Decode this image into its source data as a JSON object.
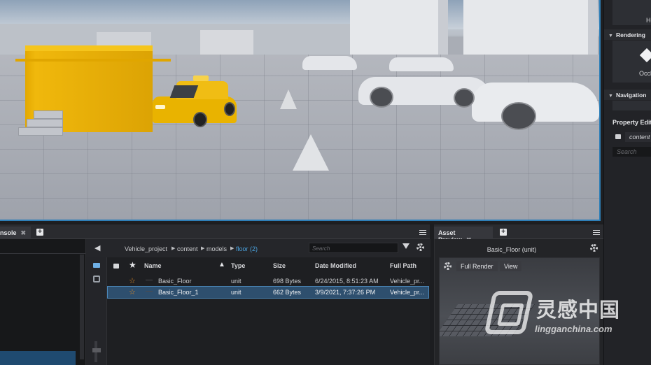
{
  "right_dock": {
    "top_label": "He",
    "section_rendering": "Rendering",
    "tile_label": "Occlud",
    "section_navigation": "Navigation",
    "property_editor_title": "Property Edito",
    "property_field_value": "content",
    "search_placeholder": "Search"
  },
  "console_panel": {
    "tab_label": "nsole"
  },
  "file_browser": {
    "breadcrumb": [
      "Vehicle_project",
      "content",
      "models"
    ],
    "current_folder": "floor (2)",
    "search_placeholder": "Search",
    "columns": [
      "Name",
      "Type",
      "Size",
      "Date Modified",
      "Full Path"
    ],
    "rows": [
      {
        "name": "Basic_Floor",
        "type": "unit",
        "size": "698 Bytes",
        "date": "6/24/2015, 8:51:23 AM",
        "path": "Vehicle_pr...",
        "selected": false
      },
      {
        "name": "Basic_Floor_1",
        "type": "unit",
        "size": "662 Bytes",
        "date": "3/9/2021, 7:37:26 PM",
        "path": "Vehicle_pr...",
        "selected": true
      }
    ]
  },
  "asset_preview": {
    "tab_label": "Asset Preview",
    "title": "Basic_Floor (unit)",
    "full_render_label": "Full Render",
    "view_label": "View"
  },
  "watermark": {
    "brand": "灵感中国",
    "site": "lingganchina.com"
  },
  "colors": {
    "accent_blue": "#2e7fb8",
    "selection": "#2e4f6e",
    "star": "#e08a25",
    "taxi_yellow": "#e9b300"
  }
}
